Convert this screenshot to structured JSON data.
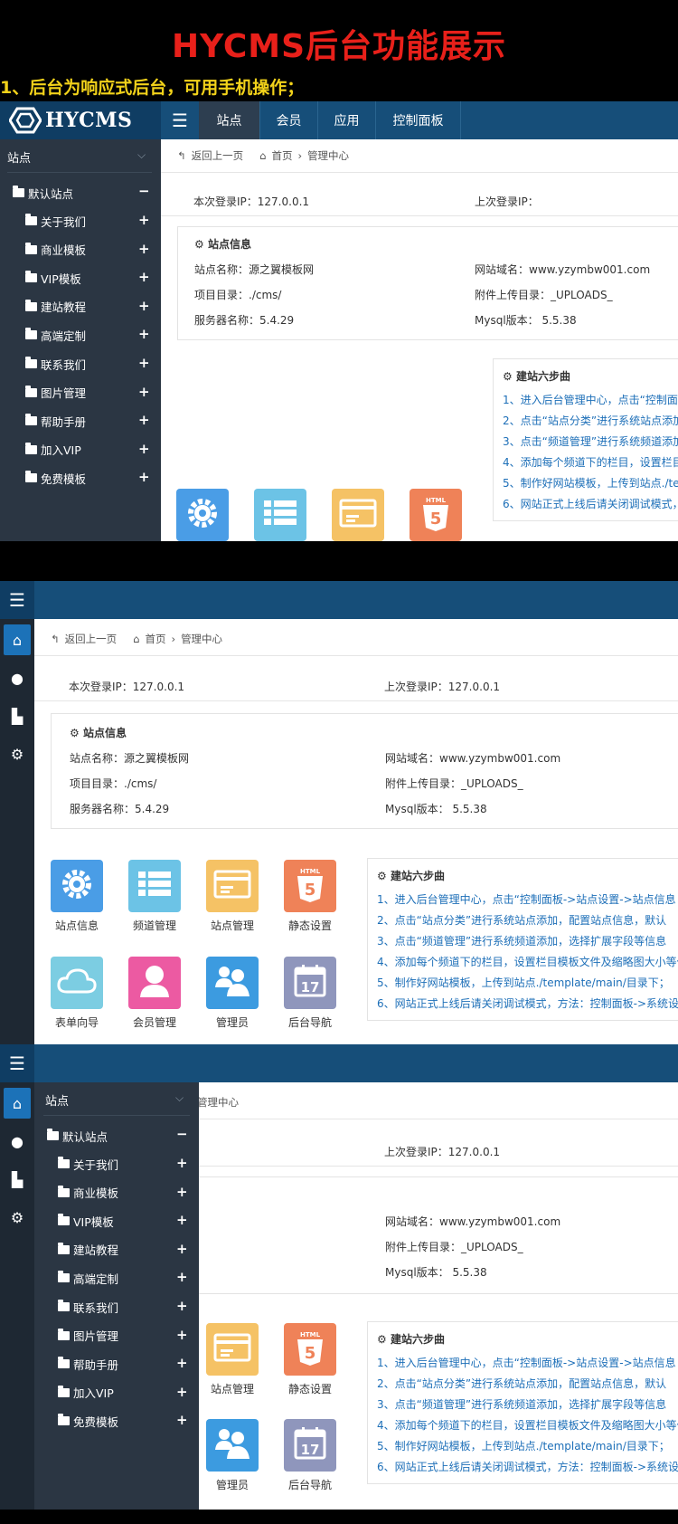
{
  "promo": {
    "title": "HYCMS后台功能展示",
    "subtitle": "1、后台为响应式后台，可用手机操作；"
  },
  "app": {
    "logo_text": "HYCMS",
    "nav_tabs": [
      "站点",
      "会员",
      "应用",
      "控制面板"
    ]
  },
  "sidebar": {
    "header": "站点",
    "root": "默认站点",
    "items": [
      "关于我们",
      "商业模板",
      "VIP模板",
      "建站教程",
      "高端定制",
      "联系我们",
      "图片管理",
      "帮助手册",
      "加入VIP",
      "免费模板"
    ]
  },
  "breadcrumb": {
    "back": "返回上一页",
    "home": "首页",
    "current": "管理中心"
  },
  "login": {
    "this_ip": "本次登录IP：127.0.0.1",
    "last_ip_empty": "上次登录IP：",
    "last_ip": "上次登录IP：127.0.0.1"
  },
  "site_info": {
    "title": "站点信息",
    "site_name": "站点名称：源之翼模板网",
    "domain": "网站域名：www.yzymbw001.com",
    "project_dir": "项目目录：./cms/",
    "upload_dir": "附件上传目录：_UPLOADS_",
    "server": "服务器名称：5.4.29",
    "mysql": "Mysql版本： 5.5.38"
  },
  "tiles": [
    {
      "label": "站点信息",
      "icon": "gear-icon",
      "color": "#4a9de6"
    },
    {
      "label": "频道管理",
      "icon": "list-icon",
      "color": "#6cc3e6"
    },
    {
      "label": "站点管理",
      "icon": "card-icon",
      "color": "#f5c265"
    },
    {
      "label": "静态设置",
      "icon": "html5-icon",
      "color": "#ef8258"
    },
    {
      "label": "表单向导",
      "icon": "cloud-icon",
      "color": "#7ccde2"
    },
    {
      "label": "会员管理",
      "icon": "user-icon",
      "color": "#ec5aa2"
    },
    {
      "label": "管理员",
      "icon": "users-icon",
      "color": "#3c9be0"
    },
    {
      "label": "后台导航",
      "icon": "calendar-icon",
      "color": "#8f96bc"
    }
  ],
  "steps": {
    "title": "建站六步曲",
    "items": [
      "1、进入后台管理中心，点击“控制面板->站点设置->站点信息",
      "2、点击“站点分类”进行系统站点添加，配置站点信息，默认",
      "3、点击“频道管理”进行系统频道添加，选择扩展字段等信息",
      "4、添加每个频道下的栏目，设置栏目模板文件及缩略图大小等信",
      "5、制作好网站模板，上传到站点./template/main/目录下；",
      "6、网站正式上线后请关闭调试模式，方法：控制面板->系统设"
    ]
  }
}
